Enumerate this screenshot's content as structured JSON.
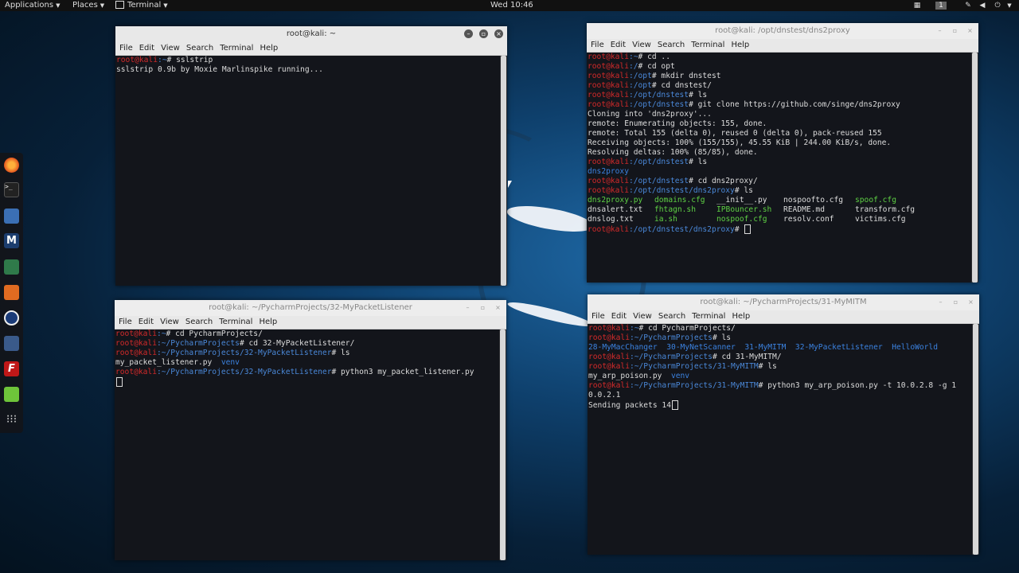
{
  "top_panel": {
    "applications": "Applications",
    "places": "Places",
    "terminal": "Terminal",
    "clock": "Wed 10:46",
    "workspace": "1"
  },
  "dock": {
    "items": [
      "firefox-icon",
      "terminal-icon",
      "files-icon",
      "metasploit-icon",
      "armitage-icon",
      "burpsuite-icon",
      "maltego-icon",
      "beef-icon",
      "faraday-icon",
      "leafpad-icon",
      "show-apps-icon"
    ]
  },
  "windows": {
    "sslstrip": {
      "title": "root@kali: ~",
      "menu": [
        "File",
        "Edit",
        "View",
        "Search",
        "Terminal",
        "Help"
      ],
      "lines": [
        {
          "u": "root@kali",
          "p": ":~",
          "c": "# sslstrip"
        },
        {
          "t": ""
        },
        {
          "t": "sslstrip 0.9b by Moxie Marlinspike running..."
        }
      ]
    },
    "dns2proxy": {
      "title": "root@kali: /opt/dnstest/dns2proxy",
      "menu": [
        "File",
        "Edit",
        "View",
        "Search",
        "Terminal",
        "Help"
      ],
      "lines": [
        {
          "u": "root@kali",
          "p": ":~",
          "c": "# cd .."
        },
        {
          "u": "root@kali",
          "p": ":/",
          "c": "# cd opt"
        },
        {
          "u": "root@kali",
          "p": ":/opt",
          "c": "# mkdir dnstest"
        },
        {
          "u": "root@kali",
          "p": ":/opt",
          "c": "# cd dnstest/"
        },
        {
          "u": "root@kali",
          "p": ":/opt/dnstest",
          "c": "# ls"
        },
        {
          "u": "root@kali",
          "p": ":/opt/dnstest",
          "c": "# git clone https://github.com/singe/dns2proxy"
        },
        {
          "t": "Cloning into 'dns2proxy'..."
        },
        {
          "t": "remote: Enumerating objects: 155, done."
        },
        {
          "t": "remote: Total 155 (delta 0), reused 0 (delta 0), pack-reused 155"
        },
        {
          "t": "Receiving objects: 100% (155/155), 45.55 KiB | 244.00 KiB/s, done."
        },
        {
          "t": "Resolving deltas: 100% (85/85), done."
        },
        {
          "u": "root@kali",
          "p": ":/opt/dnstest",
          "c": "# ls"
        },
        {
          "d": "dns2proxy"
        },
        {
          "u": "root@kali",
          "p": ":/opt/dnstest",
          "c": "# cd dns2proxy/"
        },
        {
          "u": "root@kali",
          "p": ":/opt/dnstest/dns2proxy",
          "c": "# ls"
        }
      ],
      "ls_rows": [
        [
          {
            "g": "dns2proxy.py"
          },
          {
            "g": "domains.cfg"
          },
          {
            "t": "__init__.py"
          },
          {
            "t": "nospoofto.cfg"
          },
          {
            "g": "spoof.cfg"
          }
        ],
        [
          {
            "t": "dnsalert.txt"
          },
          {
            "g": "fhtagn.sh"
          },
          {
            "g": "IPBouncer.sh"
          },
          {
            "t": "README.md"
          },
          {
            "t": "transform.cfg"
          }
        ],
        [
          {
            "t": "dnslog.txt"
          },
          {
            "g": "ia.sh"
          },
          {
            "g": "nospoof.cfg"
          },
          {
            "t": "resolv.conf"
          },
          {
            "t": "victims.cfg"
          }
        ]
      ],
      "last_prompt": {
        "u": "root@kali",
        "p": ":/opt/dnstest/dns2proxy",
        "c": "# "
      }
    },
    "listener": {
      "title": "root@kali: ~/PycharmProjects/32-MyPacketListener",
      "menu": [
        "File",
        "Edit",
        "View",
        "Search",
        "Terminal",
        "Help"
      ],
      "lines": [
        {
          "u": "root@kali",
          "p": ":~",
          "c": "# cd PycharmProjects/"
        },
        {
          "u": "root@kali",
          "p": ":~/PycharmProjects",
          "c": "# cd 32-MyPacketListener/"
        },
        {
          "u": "root@kali",
          "p": ":~/PycharmProjects/32-MyPacketListener",
          "c": "# ls"
        },
        {
          "t": "my_packet_listener.py  ",
          "d": "venv"
        },
        {
          "u": "root@kali",
          "p": ":~/PycharmProjects/32-MyPacketListener",
          "c": "# python3 my_packet_listener.py"
        }
      ]
    },
    "mitm": {
      "title": "root@kali: ~/PycharmProjects/31-MyMITM",
      "menu": [
        "File",
        "Edit",
        "View",
        "Search",
        "Terminal",
        "Help"
      ],
      "lines": [
        {
          "u": "root@kali",
          "p": ":~",
          "c": "# cd PycharmProjects/"
        },
        {
          "u": "root@kali",
          "p": ":~/PycharmProjects",
          "c": "# ls"
        },
        {
          "d": "28-MyMacChanger  30-MyNetScanner  31-MyMITM  32-MyPacketListener  HelloWorld"
        },
        {
          "u": "root@kali",
          "p": ":~/PycharmProjects",
          "c": "# cd 31-MyMITM/"
        },
        {
          "u": "root@kali",
          "p": ":~/PycharmProjects/31-MyMITM",
          "c": "# ls"
        },
        {
          "t": "my_arp_poison.py  ",
          "d": "venv"
        },
        {
          "u": "root@kali",
          "p": ":~/PycharmProjects/31-MyMITM",
          "c": "# python3 my_arp_poison.py -t 10.0.2.8 -g 1"
        },
        {
          "t": "0.0.2.1"
        }
      ],
      "status": "Sending packets 14"
    }
  }
}
